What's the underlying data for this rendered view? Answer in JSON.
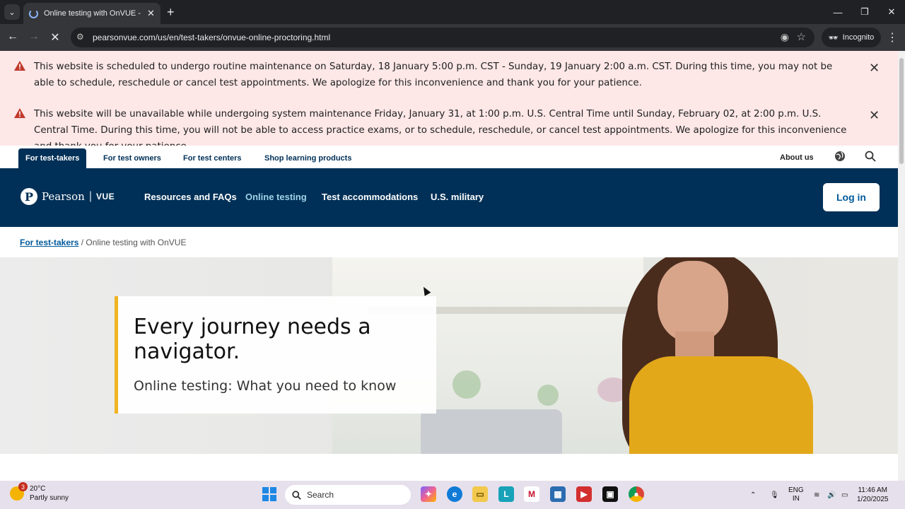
{
  "browser": {
    "tab_title": "Online testing with OnVUE - Pe",
    "url": "pearsonvue.com/us/en/test-takers/onvue-online-proctoring.html",
    "mode_label": "Incognito"
  },
  "alerts": [
    {
      "text": "This website is scheduled to undergo routine maintenance on Saturday, 18 January 5:00 p.m. CST - Sunday, 19 January 2:00 a.m. CST. During this time, you may not be able to schedule, reschedule or cancel test appointments. We apologize for this inconvenience and thank you for your patience."
    },
    {
      "text": "This website will be unavailable while undergoing system maintenance Friday, January 31, at 1:00 p.m. U.S. Central Time until Sunday, February 02, at 2:00 p.m. U.S. Central Time. During this time, you will not be able to access practice exams, or to schedule, reschedule, or cancel test appointments. We apologize for this inconvenience and thank you for your patience."
    }
  ],
  "utility_nav": {
    "items": [
      "For test-takers",
      "For test owners",
      "For test centers",
      "Shop learning products"
    ],
    "about": "About us"
  },
  "main_nav": {
    "logo_name": "Pearson",
    "logo_sub": "VUE",
    "links": [
      "Resources and FAQs",
      "Online testing",
      "Test accommodations",
      "U.S. military"
    ],
    "login": "Log in"
  },
  "breadcrumb": {
    "parent": "For test-takers",
    "separator": "/",
    "current": "Online testing with OnVUE"
  },
  "hero": {
    "heading": "Every journey needs a navigator.",
    "subheading": "Online testing: What you need to know"
  },
  "taskbar": {
    "weather_badge": "3",
    "temperature": "20°C",
    "condition": "Partly sunny",
    "search_label": "Search",
    "language_1": "ENG",
    "language_2": "IN",
    "time": "11:46 AM",
    "date": "1/20/2025"
  },
  "colors": {
    "brand_navy": "#003057",
    "accent_yellow": "#f0b323",
    "alert_bg": "#fde7e7",
    "link_blue": "#005a9c"
  }
}
